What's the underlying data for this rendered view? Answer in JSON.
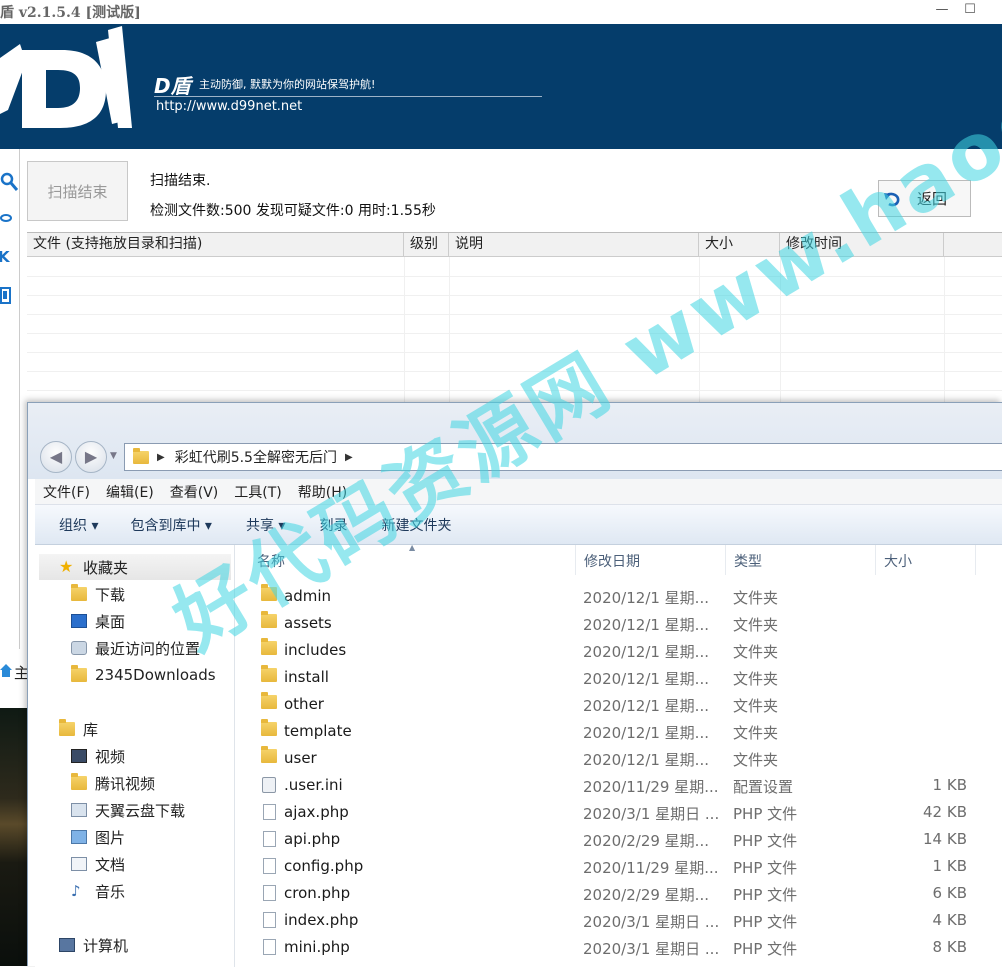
{
  "app": {
    "title": "盾 v2.1.5.4 [测试版]",
    "brand": "D盾",
    "slogan": "主动防御, 默默为你的网站保驾护航!",
    "url": "http://www.d99net.net",
    "minimize_icon": "minimize-icon",
    "maximize_icon": "maximize-icon",
    "banner_color": "#053d6b"
  },
  "sidebar": [
    "search-icon",
    "link-icon",
    "k-icon",
    "grid-icon"
  ],
  "scan": {
    "button_label": "扫描结束",
    "status": "扫描结束.",
    "stats": "检测文件数:500 发现可疑文件:0 用时:1.55秒",
    "back_label": "返回"
  },
  "results": {
    "columns": [
      "文件 (支持拖放目录和扫描)",
      "级别",
      "说明",
      "大小",
      "修改时间"
    ],
    "rows": []
  },
  "left_fragment": {
    "label": "主"
  },
  "explorer": {
    "path": "彩虹代刷5.5全解密无后门",
    "menu": [
      "文件(F)",
      "编辑(E)",
      "查看(V)",
      "工具(T)",
      "帮助(H)"
    ],
    "toolbar": [
      "组织 ▾",
      "包含到库中 ▾",
      "共享 ▾",
      "刻录",
      "新建文件夹"
    ],
    "nav": {
      "favorites": "收藏夹",
      "favorites_items": [
        "下载",
        "桌面",
        "最近访问的位置",
        "2345Downloads"
      ],
      "library": "库",
      "library_items": [
        "视频",
        "腾讯视频",
        "天翼云盘下载",
        "图片",
        "文档",
        "音乐"
      ],
      "computer": "计算机"
    },
    "columns": [
      "名称",
      "修改日期",
      "类型",
      "大小"
    ],
    "files": [
      {
        "name": "admin",
        "date": "2020/12/1 星期...",
        "type": "文件夹",
        "size": "",
        "icon": "folder-icon"
      },
      {
        "name": "assets",
        "date": "2020/12/1 星期...",
        "type": "文件夹",
        "size": "",
        "icon": "folder-icon"
      },
      {
        "name": "includes",
        "date": "2020/12/1 星期...",
        "type": "文件夹",
        "size": "",
        "icon": "folder-icon"
      },
      {
        "name": "install",
        "date": "2020/12/1 星期...",
        "type": "文件夹",
        "size": "",
        "icon": "folder-icon"
      },
      {
        "name": "other",
        "date": "2020/12/1 星期...",
        "type": "文件夹",
        "size": "",
        "icon": "folder-icon"
      },
      {
        "name": "template",
        "date": "2020/12/1 星期...",
        "type": "文件夹",
        "size": "",
        "icon": "folder-icon"
      },
      {
        "name": "user",
        "date": "2020/12/1 星期...",
        "type": "文件夹",
        "size": "",
        "icon": "folder-icon"
      },
      {
        "name": ".user.ini",
        "date": "2020/11/29 星期...",
        "type": "配置设置",
        "size": "1 KB",
        "icon": "config-file-icon"
      },
      {
        "name": "ajax.php",
        "date": "2020/3/1 星期日 ...",
        "type": "PHP 文件",
        "size": "42 KB",
        "icon": "file-icon"
      },
      {
        "name": "api.php",
        "date": "2020/2/29 星期...",
        "type": "PHP 文件",
        "size": "14 KB",
        "icon": "file-icon"
      },
      {
        "name": "config.php",
        "date": "2020/11/29 星期...",
        "type": "PHP 文件",
        "size": "1 KB",
        "icon": "file-icon"
      },
      {
        "name": "cron.php",
        "date": "2020/2/29 星期...",
        "type": "PHP 文件",
        "size": "6 KB",
        "icon": "file-icon"
      },
      {
        "name": "index.php",
        "date": "2020/3/1 星期日 ...",
        "type": "PHP 文件",
        "size": "4 KB",
        "icon": "file-icon"
      },
      {
        "name": "mini.php",
        "date": "2020/3/1 星期日 ...",
        "type": "PHP 文件",
        "size": "8 KB",
        "icon": "file-icon"
      }
    ]
  },
  "watermark": "好代码资源网 www.haodaima.cc"
}
